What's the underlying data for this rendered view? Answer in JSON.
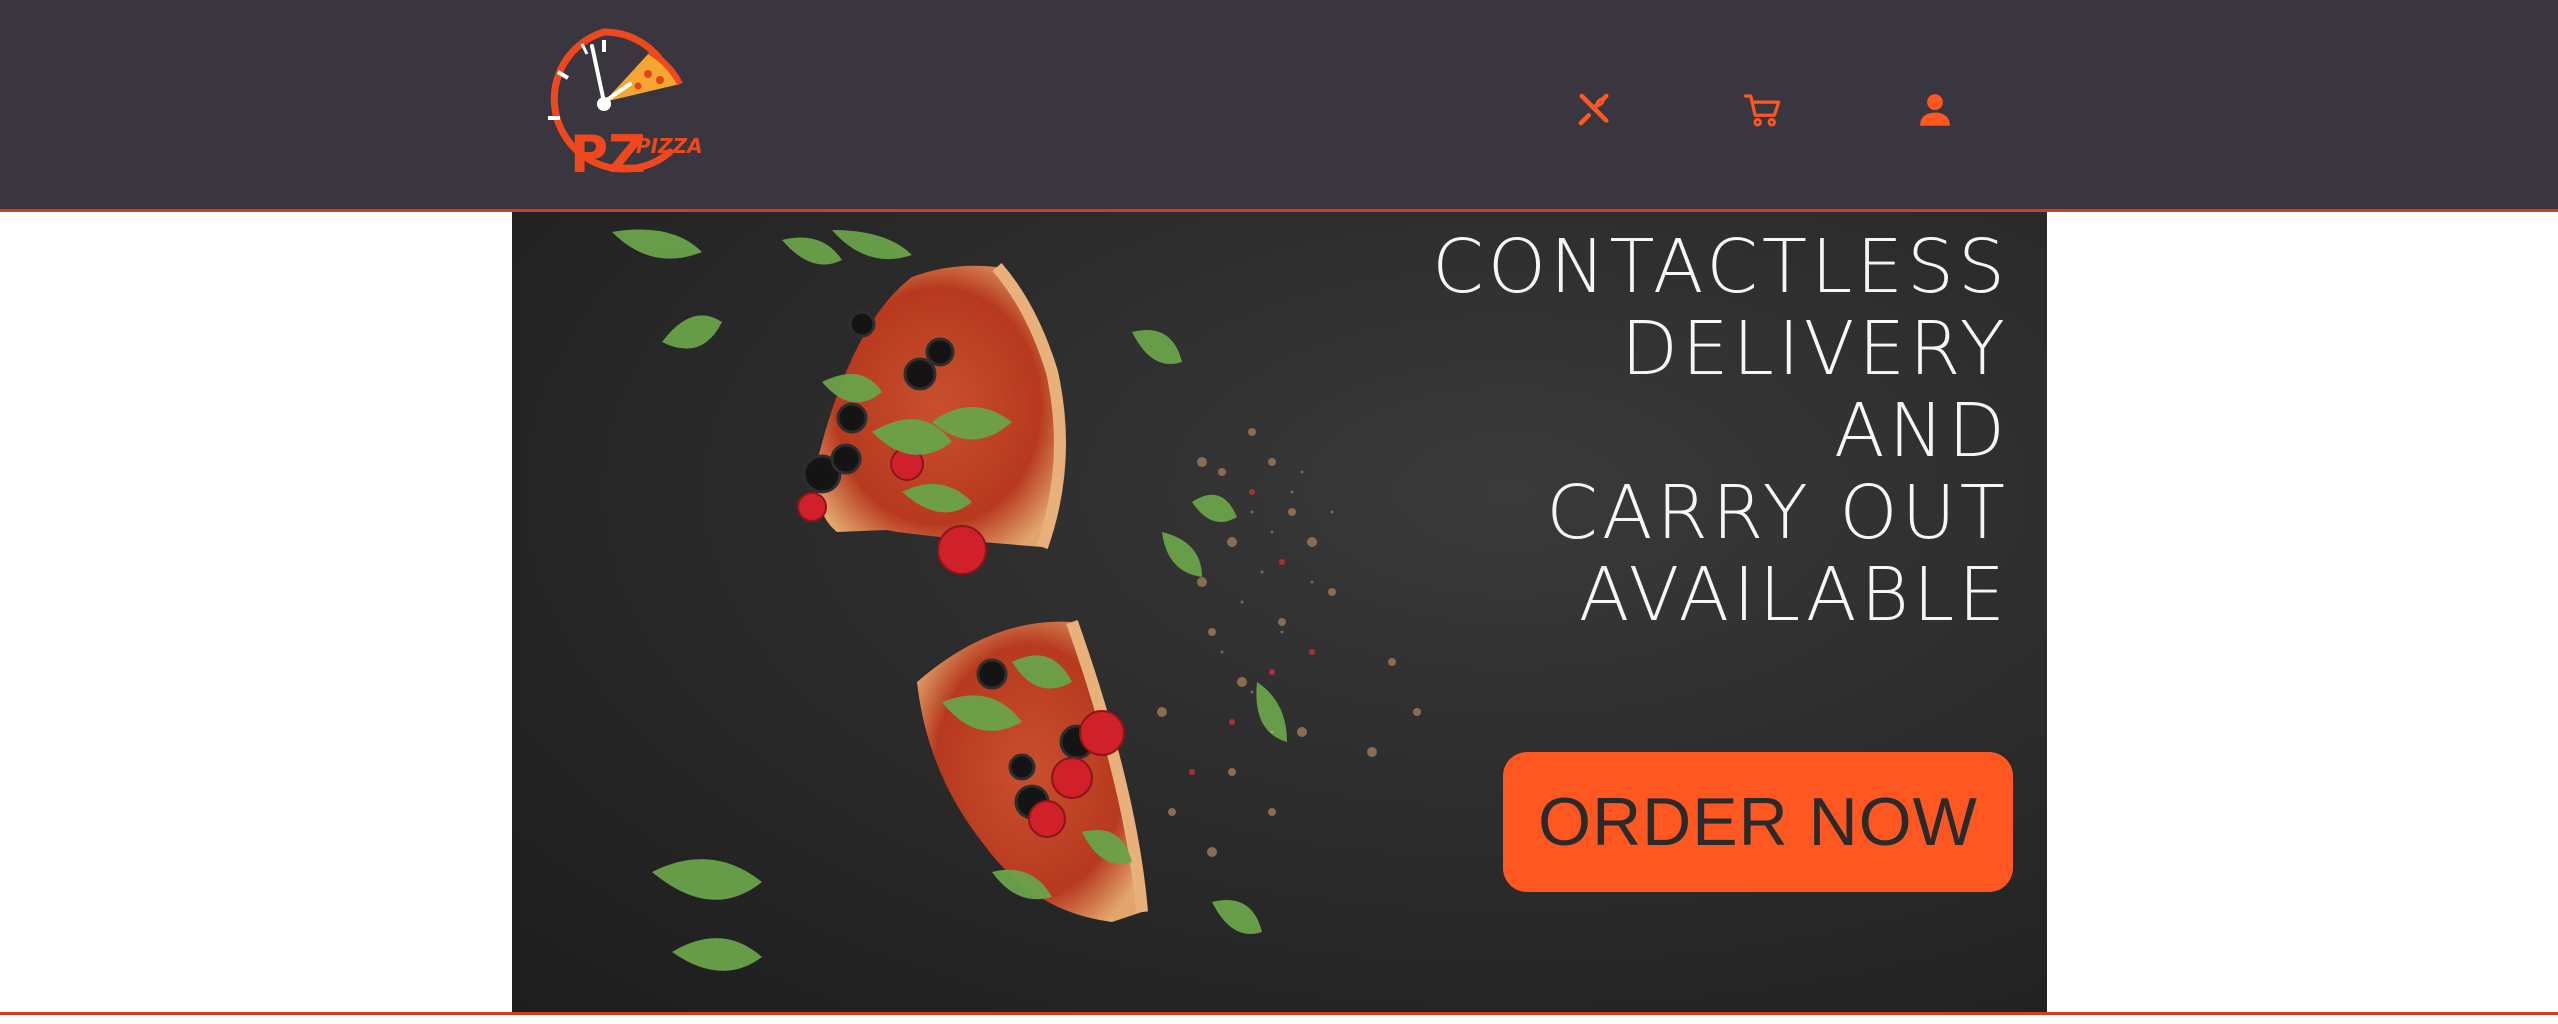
{
  "header": {
    "logo": {
      "text_pz": "PZ",
      "text_pizza": "PIZZA",
      "alt": "PZ Pizza logo"
    },
    "nav": [
      {
        "icon": "utensils-icon",
        "label": ""
      },
      {
        "icon": "cart-icon",
        "label": ""
      },
      {
        "icon": "user-icon",
        "label": ""
      }
    ]
  },
  "hero": {
    "headline_lines": [
      "CONTACTLESS",
      "DELIVERY",
      "AND",
      "CARRY OUT",
      "AVAILABLE"
    ],
    "cta_label": "ORDER NOW"
  },
  "colors": {
    "header_bg": "#39363f",
    "accent": "#ff5722",
    "accent_dark": "#d43c1f",
    "hero_text": "#f6f6f6"
  }
}
